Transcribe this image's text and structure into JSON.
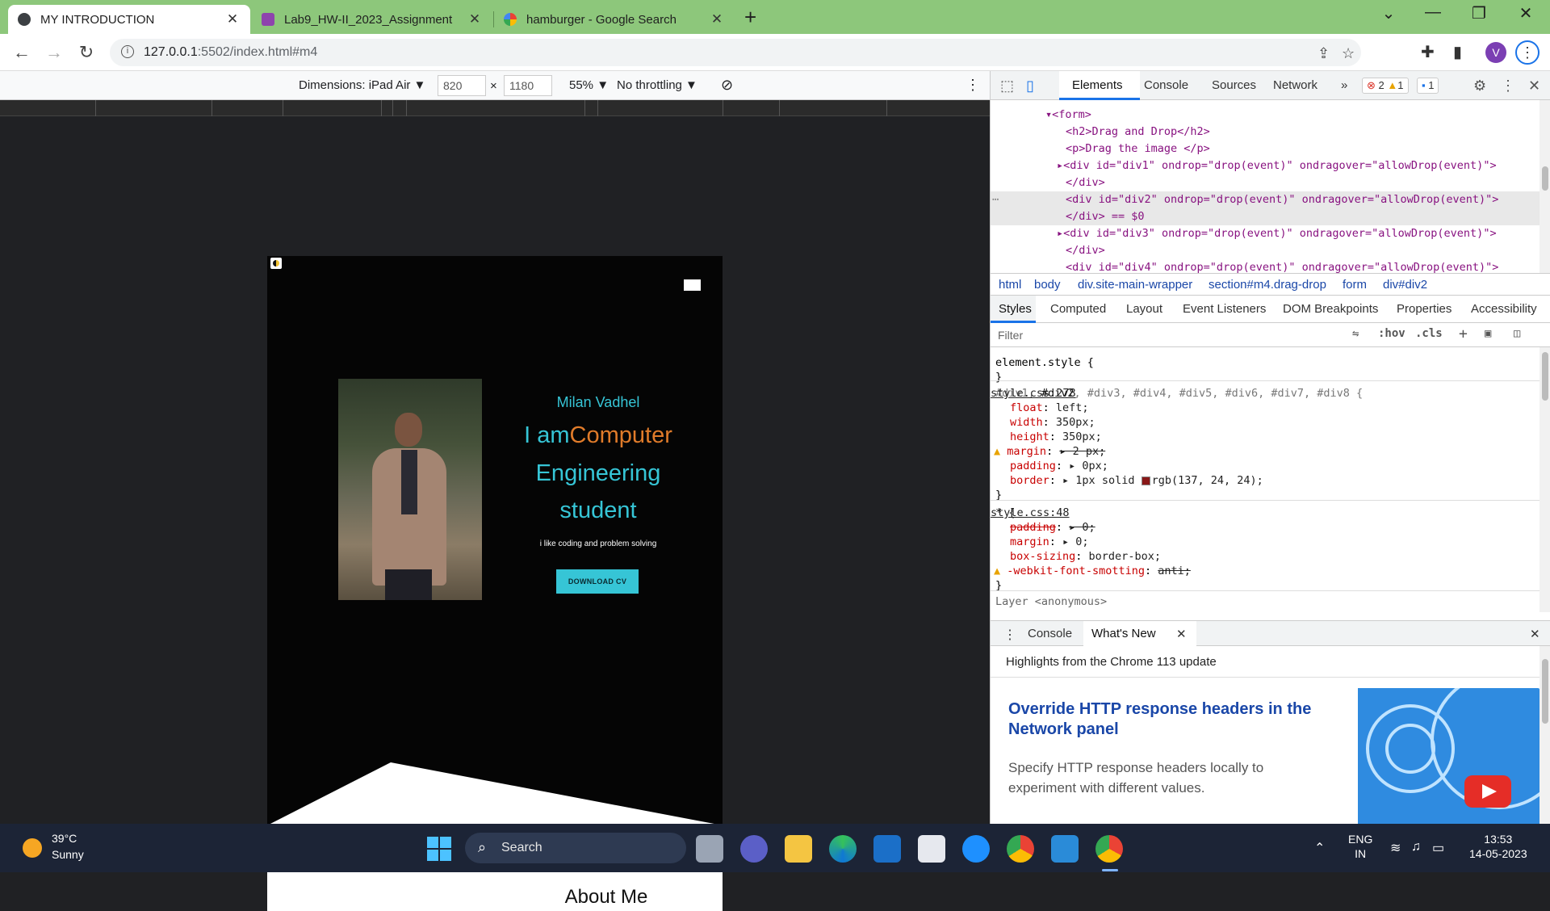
{
  "browser": {
    "tabs": [
      {
        "title": "MY INTRODUCTION",
        "active": true
      },
      {
        "title": "Lab9_HW-II_2023_Assignment",
        "active": false
      },
      {
        "title": "hamburger - Google Search",
        "active": false
      }
    ],
    "url_host": "127.0.0.1",
    "url_rest": ":5502/index.html#m4",
    "profile_initial": "V"
  },
  "device_toolbar": {
    "dimensions_label": "Dimensions: iPad Air ▼",
    "width": "820",
    "times": "×",
    "height": "1180",
    "zoom": "55% ▼",
    "throttling": "No throttling ▼"
  },
  "page": {
    "name": "Milan Vadhel",
    "line1_prefix": "I am",
    "line1_accent": "Computer",
    "line2": "Engineering",
    "line3": "student",
    "subtitle": "i like coding and problem solving",
    "cv_button": "DOWNLOAD CV",
    "about_title": "About Me"
  },
  "devtools": {
    "tabs": [
      "Elements",
      "Console",
      "Sources",
      "Network",
      "»"
    ],
    "errors": "2",
    "warnings": "1",
    "messages": "1",
    "dom": {
      "form_open": "<form>",
      "h2": "<h2>Drag and Drop</h2>",
      "p": "<p>Drag the image </p>",
      "div1": "<div id=\"div1\" ondrop=\"drop(event)\" ondragover=\"allowDrop(event)\">",
      "div_close": "</div>",
      "div2": "<div id=\"div2\" ondrop=\"drop(event)\" ondragover=\"allowDrop(event)\">",
      "div2_close": "</div> == $0",
      "div3": "<div id=\"div3\" ondrop=\"drop(event)\" ondragover=\"allowDrop(event)\">",
      "div4": "<div id=\"div4\" ondrop=\"drop(event)\" ondragover=\"allowDrop(event)\">"
    },
    "breadcrumbs": [
      "html",
      "body",
      "div.site-main-wrapper",
      "section#m4.drag-drop",
      "form",
      "div#div2"
    ],
    "sub_tabs": [
      "Styles",
      "Computed",
      "Layout",
      "Event Listeners",
      "DOM Breakpoints",
      "Properties",
      "Accessibility"
    ],
    "filter_placeholder": "Filter",
    "filter_hov": ":hov",
    "filter_cls": ".cls",
    "styles": {
      "element_style": "element.style {",
      "close": "}",
      "rule1_selector_pre": "#div1, ",
      "rule1_selector_bold": "#div2",
      "rule1_selector_post": ", #div3, #div4, #div5, #div6, #div7, #div8 {",
      "rule1_source": "style.css:278",
      "rule1_props": [
        {
          "name": "float",
          "value": "left;"
        },
        {
          "name": "width",
          "value": "350px;"
        },
        {
          "name": "height",
          "value": "350px;"
        },
        {
          "name": "margin",
          "value": "▸ 2 px;"
        },
        {
          "name": "padding",
          "value": "▸ 0px;"
        },
        {
          "name": "border",
          "value": "▸ 1px solid "
        }
      ],
      "border_color": "rgb(137, 24, 24);",
      "rule2_selector": "* {",
      "rule2_source": "style.css:48",
      "rule2_props": [
        {
          "name": "padding",
          "value": "▸ 0;"
        },
        {
          "name": "margin",
          "value": "▸ 0;"
        },
        {
          "name": "box-sizing",
          "value": "border-box;"
        },
        {
          "name": "-webkit-font-smotting",
          "value": "anti;"
        }
      ],
      "layer_text": "Layer <anonymous>"
    },
    "drawer": {
      "tabs": [
        "Console",
        "What's New"
      ],
      "highlights": "Highlights from the Chrome 113 update",
      "title": "Override HTTP response headers in the Network panel",
      "description": "Specify HTTP response headers locally to experiment with different values."
    }
  },
  "taskbar": {
    "temperature": "39°C",
    "weather": "Sunny",
    "search": "Search",
    "lang1": "ENG",
    "lang2": "IN",
    "time": "13:53",
    "date": "14-05-2023"
  },
  "colors": {
    "accent_cyan": "#36c5d6",
    "accent_orange": "#e07b2a",
    "tabstrip_green": "#8dc77b"
  }
}
